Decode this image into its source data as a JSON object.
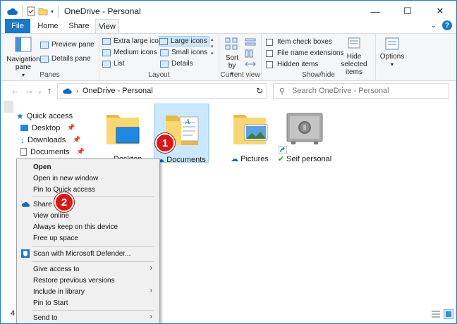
{
  "window": {
    "title": "OneDrive - Personal",
    "controls": {
      "minimize": "—",
      "maximize": "☐",
      "close": "✕"
    }
  },
  "tabs": {
    "file": "File",
    "home": "Home",
    "share": "Share",
    "view": "View"
  },
  "ribbon": {
    "panes": {
      "label": "Panes",
      "navigation_pane": "Navigation pane",
      "preview_pane": "Preview pane",
      "details_pane": "Details pane"
    },
    "layout": {
      "label": "Layout",
      "extra_large_icons": "Extra large icons",
      "large_icons": "Large icons",
      "medium_icons": "Medium icons",
      "small_icons": "Small icons",
      "list": "List",
      "details": "Details"
    },
    "current_view": {
      "label": "Current view",
      "sort_by": "Sort by"
    },
    "show_hide": {
      "label": "Show/hide",
      "item_check_boxes": "Item check boxes",
      "file_name_extensions": "File name extensions",
      "hidden_items": "Hidden items",
      "hide_selected": "Hide selected items"
    },
    "options": {
      "label": "Options"
    }
  },
  "address": {
    "path": "OneDrive - Personal",
    "search_placeholder": "Search OneDrive - Personal"
  },
  "navpane": {
    "items": [
      {
        "label": "Quick access"
      },
      {
        "label": "Desktop"
      },
      {
        "label": "Downloads"
      },
      {
        "label": "Documents"
      }
    ]
  },
  "content": {
    "items": [
      {
        "label": "Desktop"
      },
      {
        "label": "Documents"
      },
      {
        "label": "Pictures"
      },
      {
        "label": "Seif personal"
      }
    ]
  },
  "status": {
    "count": "4"
  },
  "context_menu": {
    "items": [
      {
        "label": "Open"
      },
      {
        "label": "Open in new window"
      },
      {
        "label": "Pin to Quick access"
      },
      {
        "label": "Share"
      },
      {
        "label": "View online"
      },
      {
        "label": "Always keep on this device"
      },
      {
        "label": "Free up space"
      },
      {
        "label": "Scan with Microsoft Defender..."
      },
      {
        "label": "Give access to"
      },
      {
        "label": "Restore previous versions"
      },
      {
        "label": "Include in library"
      },
      {
        "label": "Pin to Start"
      },
      {
        "label": "Send to"
      }
    ]
  },
  "annotations": {
    "badge_1": "1",
    "badge_2": "2"
  },
  "colors": {
    "accent": "#1979ca",
    "selection": "#cce8ff",
    "badge": "#d81818",
    "folder": "#f8d775"
  }
}
